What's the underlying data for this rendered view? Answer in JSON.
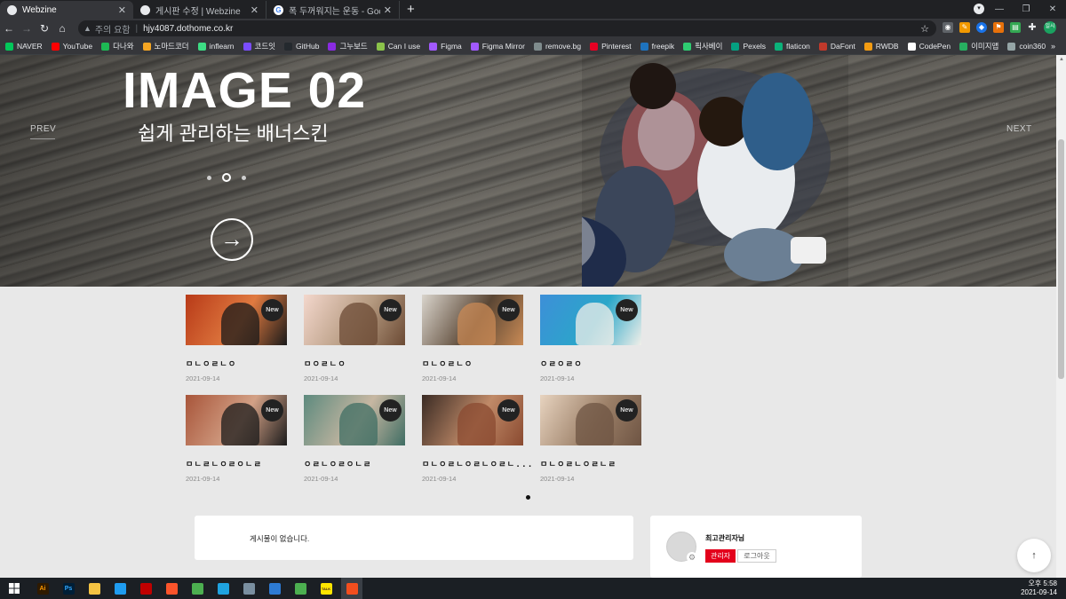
{
  "browser": {
    "tabs": [
      {
        "title": "Webzine",
        "active": true
      },
      {
        "title": "게시판 수정 | Webzine",
        "active": false
      },
      {
        "title": "폭 두꺼워지는 운동 - Google 검",
        "active": false
      }
    ],
    "omnibox": {
      "security": "주의 요함",
      "url": "hjy4087.dothome.co.kr"
    },
    "bookmarks": [
      "NAVER",
      "YouTube",
      "다나와",
      "노마드코더",
      "inflearn",
      "코드잇",
      "GitHub",
      "그누보드",
      "Can I use",
      "Figma",
      "Figma Mirror",
      "remove.bg",
      "Pinterest",
      "freepik",
      "픽사베이",
      "Pexels",
      "flaticon",
      "DaFont",
      "RWDB",
      "CodePen",
      "이미지맵",
      "coin360"
    ],
    "bookmark_colors": [
      "#03c75a",
      "#ff0000",
      "#1db954",
      "#f5a623",
      "#3ddc84",
      "#7b4dff",
      "#24292e",
      "#8a2be2",
      "#8bc34a",
      "#a259ff",
      "#a259ff",
      "#7f8c8d",
      "#e60023",
      "#1e73be",
      "#2ecc71",
      "#05a081",
      "#0bb27a",
      "#c0392b",
      "#f39c12",
      "#ffffff",
      "#27ae60",
      "#95a5a6"
    ],
    "profile_label": "일시"
  },
  "hero": {
    "title": "IMAGE 02",
    "subtitle": "쉽게 관리하는 배너스킨",
    "prev": "PREV",
    "next": "NEXT",
    "slide_count": 3,
    "active_slide": 2
  },
  "posts": [
    {
      "caption": "ㅁㄴㅇㄹㄴㅇ",
      "date": "2021-09-14",
      "badge": "New",
      "colors": [
        "#b83a18",
        "#1a1a1a",
        "#e07a40"
      ]
    },
    {
      "caption": "ㅁㅇㄹㄴㅇ",
      "date": "2021-09-14",
      "badge": "New",
      "colors": [
        "#f3d7cc",
        "#6b4a34",
        "#b59a80"
      ]
    },
    {
      "caption": "ㅁㄴㅇㄹㄴㅇ",
      "date": "2021-09-14",
      "badge": "New",
      "colors": [
        "#d9d4cc",
        "#c98a55",
        "#5a4634"
      ]
    },
    {
      "caption": "ㅇㄹㅇㄹㅇ",
      "date": "2021-09-14",
      "badge": "New",
      "colors": [
        "#3d8fd8",
        "#f1efe9",
        "#2aa7c9"
      ]
    },
    {
      "caption": "ㅁㄴㄹㄴㅇㄹㅇㄴㄹ",
      "date": "2021-09-14",
      "badge": "New",
      "colors": [
        "#a8553a",
        "#1b1b1b",
        "#d3a186"
      ]
    },
    {
      "caption": "ㅇㄹㄴㅇㄹㅇㄴㄹ",
      "date": "2021-09-14",
      "badge": "New",
      "colors": [
        "#5d8a7e",
        "#3f6d63",
        "#c7b7a2"
      ]
    },
    {
      "caption": "ㅁㄴㅇㄹㄴㅇㄹㄴㅇㄹㄴ...",
      "date": "2021-09-14",
      "badge": "New",
      "colors": [
        "#3a2b24",
        "#8a4a30",
        "#c08a68"
      ]
    },
    {
      "caption": "ㅁㄴㅇㄹㄴㅇㄹㄴㄹ",
      "date": "2021-09-14",
      "badge": "New",
      "colors": [
        "#e7d3bf",
        "#6e5443",
        "#9c8068"
      ]
    }
  ],
  "board": {
    "empty_message": "게시물이 없습니다."
  },
  "user": {
    "name": "최고관리자님",
    "admin_button": "관리자",
    "logout_button": "로그아웃"
  },
  "taskbar": {
    "apps": [
      {
        "icon": "illustrator-icon",
        "label": "Ai",
        "color": "#2f1a00"
      },
      {
        "icon": "photoshop-icon",
        "label": "Ps",
        "color": "#001e36"
      },
      {
        "icon": "file-explorer-icon",
        "label": "",
        "color": "#f5c342"
      },
      {
        "icon": "vscode-icon",
        "label": "",
        "color": "#1f9cf0"
      },
      {
        "icon": "filezilla-icon",
        "label": "",
        "color": "#bf0000"
      },
      {
        "icon": "brave-icon",
        "label": "",
        "color": "#fb542b"
      },
      {
        "icon": "chrome-icon",
        "label": "",
        "color": "#4caf50"
      },
      {
        "icon": "edge-icon",
        "label": "",
        "color": "#1fa3e0"
      },
      {
        "icon": "app-icon",
        "label": "",
        "color": "#7a8fa0"
      },
      {
        "icon": "photos-icon",
        "label": "",
        "color": "#2d7bd4"
      },
      {
        "icon": "chrome-icon",
        "label": "",
        "color": "#4caf50"
      },
      {
        "icon": "kakaotalk-icon",
        "label": "TALK",
        "color": "#fee500"
      },
      {
        "icon": "figma-icon",
        "label": "",
        "color": "#f24e1e"
      }
    ],
    "time": "오후 5:58",
    "date": "2021-09-14"
  }
}
